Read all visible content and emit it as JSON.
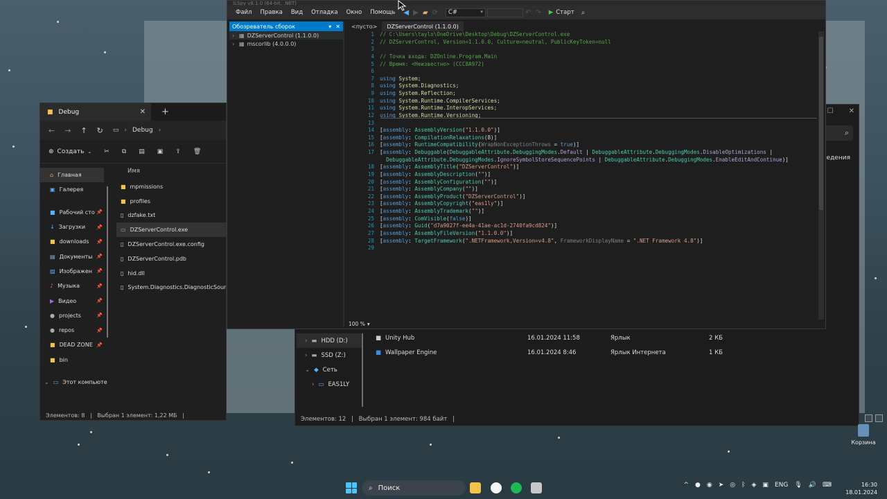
{
  "ilspy": {
    "title": "ILSpy v8.1.0 (64-bit, .NET)",
    "menu": [
      "Файл",
      "Правка",
      "Вид",
      "Отладка",
      "Окно",
      "Помощь"
    ],
    "language": "C#",
    "start_label": "Старт",
    "left_pane_title": "Обозреватель сборок",
    "tree": [
      {
        "label": "DZServerControl (1.1.0.0)",
        "selected": true
      },
      {
        "label": "mscorlib (4.0.0.0)",
        "selected": false
      }
    ],
    "tabs": [
      "<пусто>",
      "DZServerControl (1.1.0.0)"
    ],
    "zoom": "100 %",
    "line_numbers": [
      "1",
      "2",
      "3",
      "4",
      "5",
      "6",
      "7",
      "8",
      "9",
      "10",
      "11",
      "12",
      "13",
      "14",
      "15",
      "16",
      "17",
      "",
      "18",
      "19",
      "20",
      "21",
      "22",
      "23",
      "24",
      "25",
      "26",
      "27",
      "28",
      "29"
    ]
  },
  "explorer1": {
    "tab_title": "Debug",
    "breadcrumb": "Debug",
    "create_label": "Создать",
    "column_name": "Имя",
    "nav": {
      "home": "Главная",
      "gallery": "Галерея",
      "items": [
        "Рабочий сто",
        "Загрузки",
        "downloads",
        "Документы",
        "Изображен",
        "Музыка",
        "Видео",
        "projects",
        "repos",
        "DEAD ZONE",
        "bin"
      ],
      "this_pc": "Этот компьюте"
    },
    "files": [
      "mpmissions",
      "profiles",
      "dzfake.txt",
      "DZServerControl.exe",
      "DZServerControl.exe.config",
      "DZServerControl.pdb",
      "hid.dll",
      "System.Diagnostics.DiagnosticSource.d"
    ],
    "status_count": "Элементов: 8",
    "status_sel": "Выбран 1 элемент: 1,22 МБ"
  },
  "explorer2": {
    "details_label": "Сведения",
    "nav": [
      "HDD (D:)",
      "SSD (Z:)",
      "Сеть",
      "EAS1LY"
    ],
    "files": [
      {
        "name": "Unity Hub",
        "date": "16.01.2024 11:58",
        "type": "Ярлык",
        "size": "2 КБ"
      },
      {
        "name": "Wallpaper Engine",
        "date": "16.01.2024 8:46",
        "type": "Ярлык Интернета",
        "size": "1 КБ"
      }
    ],
    "status_count": "Элементов: 12",
    "status_sel": "Выбран 1 элемент: 984 байт"
  },
  "taskbar": {
    "search_label": "Поиск",
    "lang": "ENG",
    "time": "16:30",
    "date": "18.01.2024"
  },
  "desktop": {
    "recycle_label": "Корзина"
  },
  "colors": {
    "accent": "#007acc",
    "editor_bg": "#1e1e1e",
    "comment": "#57a64a",
    "keyword": "#569cd6",
    "type": "#4ec9b0",
    "string": "#d69d85"
  }
}
